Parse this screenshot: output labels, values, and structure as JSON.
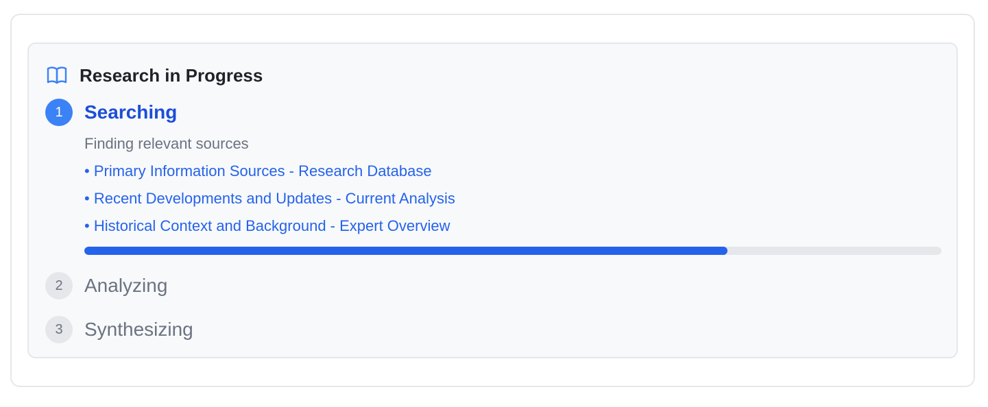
{
  "panel": {
    "title": "Research in Progress",
    "icon": "book-open-icon",
    "accent_color": "#3b82f6"
  },
  "steps": [
    {
      "number": "1",
      "label": "Searching",
      "status": "active",
      "description": "Finding relevant sources",
      "sources": [
        "• Primary Information Sources - Research Database",
        "• Recent Developments and Updates - Current Analysis",
        "• Historical Context and Background - Expert Overview"
      ],
      "progress": 0.75
    },
    {
      "number": "2",
      "label": "Analyzing",
      "status": "pending"
    },
    {
      "number": "3",
      "label": "Synthesizing",
      "status": "pending"
    }
  ]
}
